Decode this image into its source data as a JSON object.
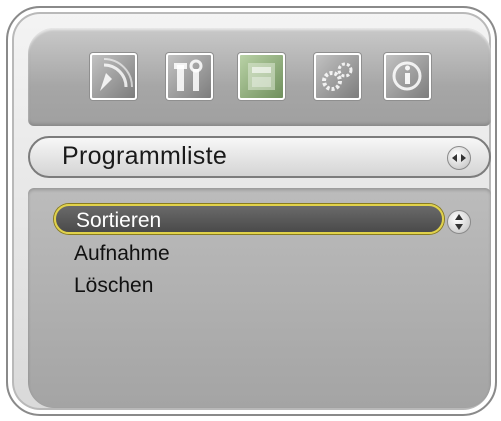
{
  "icons": [
    {
      "name": "satellite-icon",
      "active": false
    },
    {
      "name": "tools-icon",
      "active": false
    },
    {
      "name": "channel-list-icon",
      "active": true
    },
    {
      "name": "settings-gears-icon",
      "active": false
    },
    {
      "name": "info-icon",
      "active": false
    }
  ],
  "header": {
    "title": "Programmliste"
  },
  "menu": {
    "items": [
      {
        "label": "Sortieren"
      },
      {
        "label": "Aufnahme"
      },
      {
        "label": "Löschen"
      }
    ],
    "selected_index": 0
  },
  "colors": {
    "selection_border": "#e1d24a",
    "selection_fill": "#555555",
    "active_icon": "#8fae7a"
  }
}
